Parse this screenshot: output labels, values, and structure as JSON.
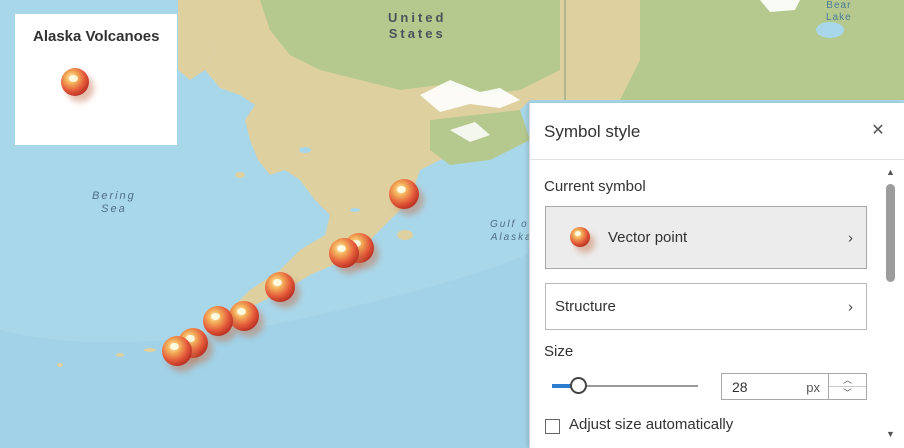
{
  "map": {
    "labels": {
      "country": "United\nStates",
      "sea": "Bering\nSea",
      "gulf": "Gulf of\nAlaska",
      "lake": "Bear\nLake"
    },
    "colors": {
      "water": "#a9d7ea",
      "land": "#dfd0a0",
      "forest": "#b5c98f",
      "snow": "#ffffff"
    }
  },
  "legend": {
    "title": "Alaska Volcanoes",
    "symbol_icon": "volcano-marker-icon"
  },
  "panel": {
    "title": "Symbol style",
    "close_icon": "close-icon",
    "current_symbol_label": "Current symbol",
    "current_symbol_value": "Vector point",
    "structure_label": "Structure",
    "size_label": "Size",
    "size_value": "28",
    "size_unit": "px",
    "slider_level": 0.18,
    "adjust_size_label": "Adjust size automatically",
    "adjust_size_checked": false
  },
  "colors": {
    "accent": "#2b7bd0",
    "volcano": "#e45a3a"
  }
}
